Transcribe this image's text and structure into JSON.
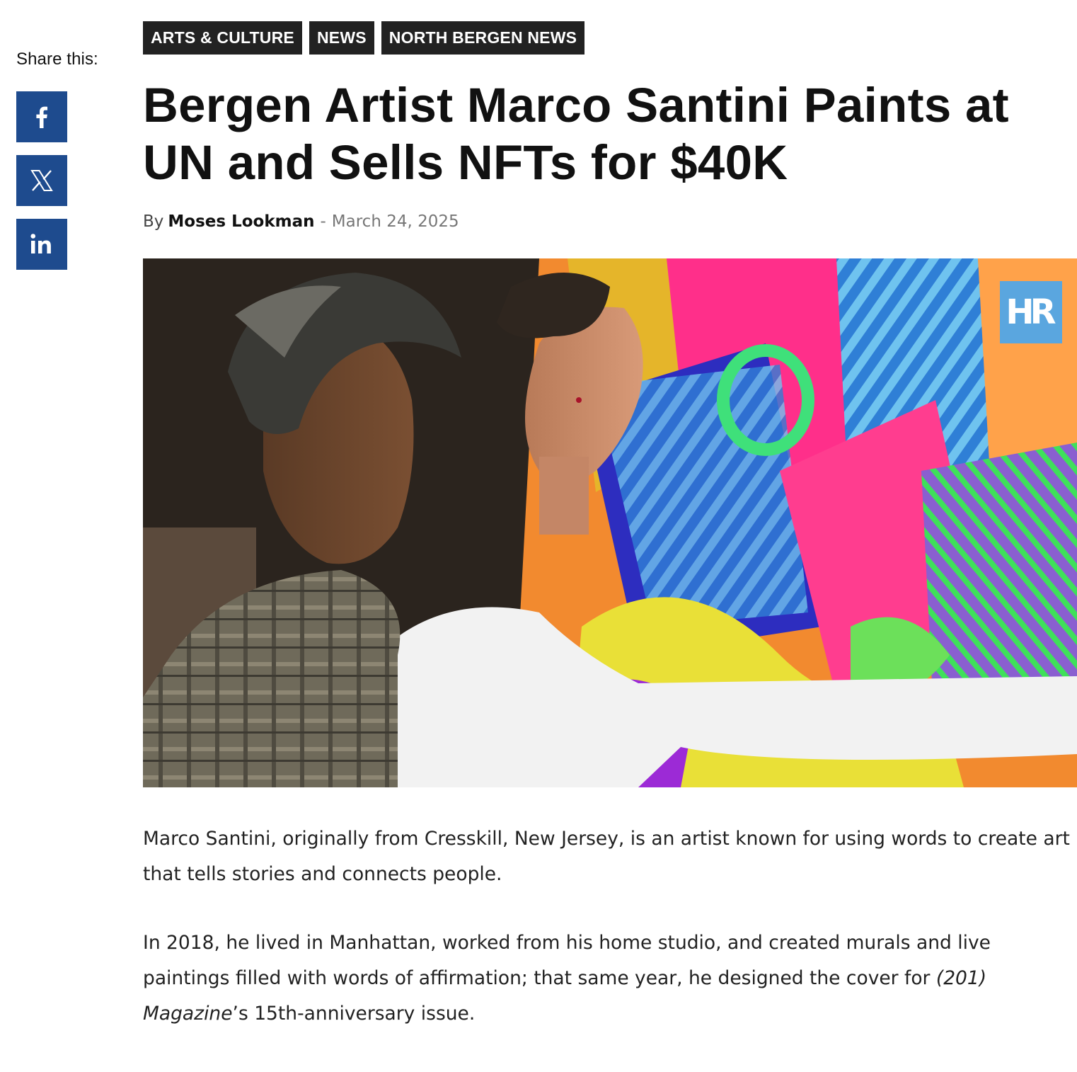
{
  "share": {
    "label": "Share this:",
    "buttons": [
      {
        "network": "facebook",
        "icon": "facebook-icon"
      },
      {
        "network": "x",
        "icon": "x-icon"
      },
      {
        "network": "linkedin",
        "icon": "linkedin-icon"
      }
    ]
  },
  "categories": [
    "ARTS & CULTURE",
    "NEWS",
    "NORTH BERGEN NEWS"
  ],
  "article": {
    "title": "Bergen Artist Marco Santini Paints at UN and Sells NFTs for $40K",
    "byline": {
      "prefix": "By",
      "author": "Moses Lookman",
      "separator": "-",
      "date": "March 24, 2025"
    },
    "hero_logo": "HR",
    "paragraphs": [
      {
        "text": "Marco Santini, originally from Cresskill, New Jersey, is an artist known for using words to create art that tells stories and connects people."
      },
      {
        "text_before": "In 2018, he lived in Manhattan, worked from his home studio, and created murals and live paintings filled with words of affirmation; that same year, he designed the cover for ",
        "italic": "(201) Magazine",
        "text_after": "’s 15th-anniversary issue."
      }
    ]
  },
  "colors": {
    "share_button": "#1e4b8e",
    "tag_background": "#222222",
    "logo_background": "#5aa6df"
  }
}
